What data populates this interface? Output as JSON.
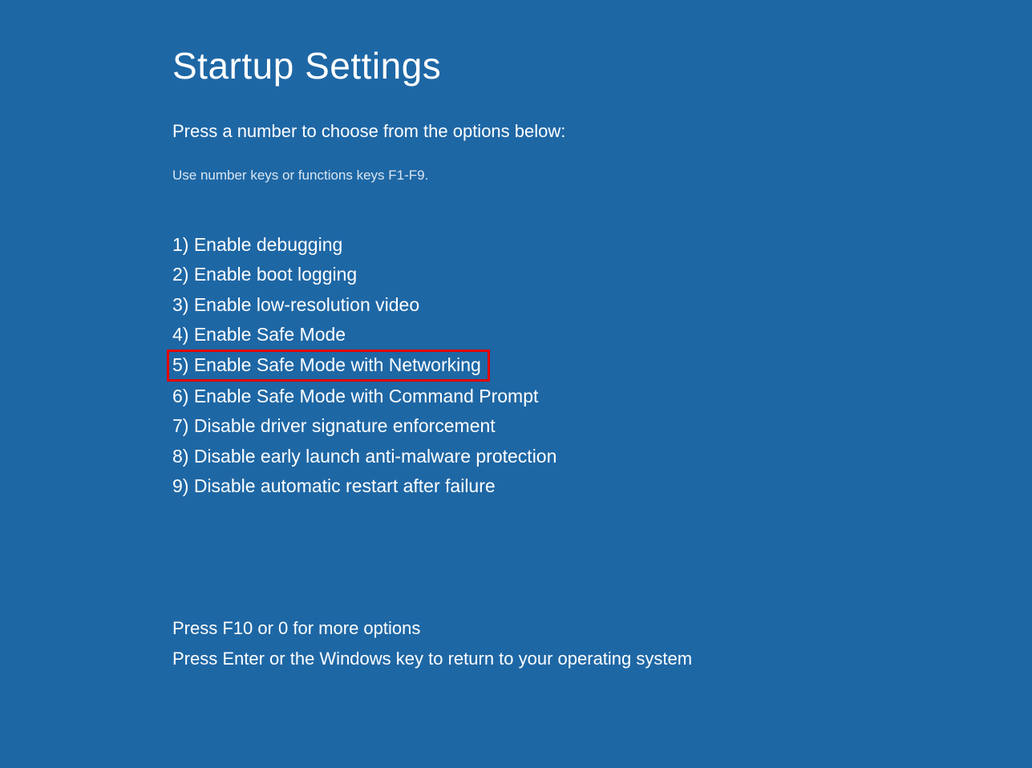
{
  "title": "Startup Settings",
  "instruction": "Press a number to choose from the options below:",
  "hint": "Use number keys or functions keys F1-F9.",
  "options": [
    "1) Enable debugging",
    "2) Enable boot logging",
    "3) Enable low-resolution video",
    "4) Enable Safe Mode",
    "5) Enable Safe Mode with Networking",
    "6) Enable Safe Mode with Command Prompt",
    "7) Disable driver signature enforcement",
    "8) Disable early launch anti-malware protection",
    "9) Disable automatic restart after failure"
  ],
  "footer_line1": "Press F10 or 0 for more options",
  "footer_line2": "Press Enter or the Windows key to return to your operating system"
}
